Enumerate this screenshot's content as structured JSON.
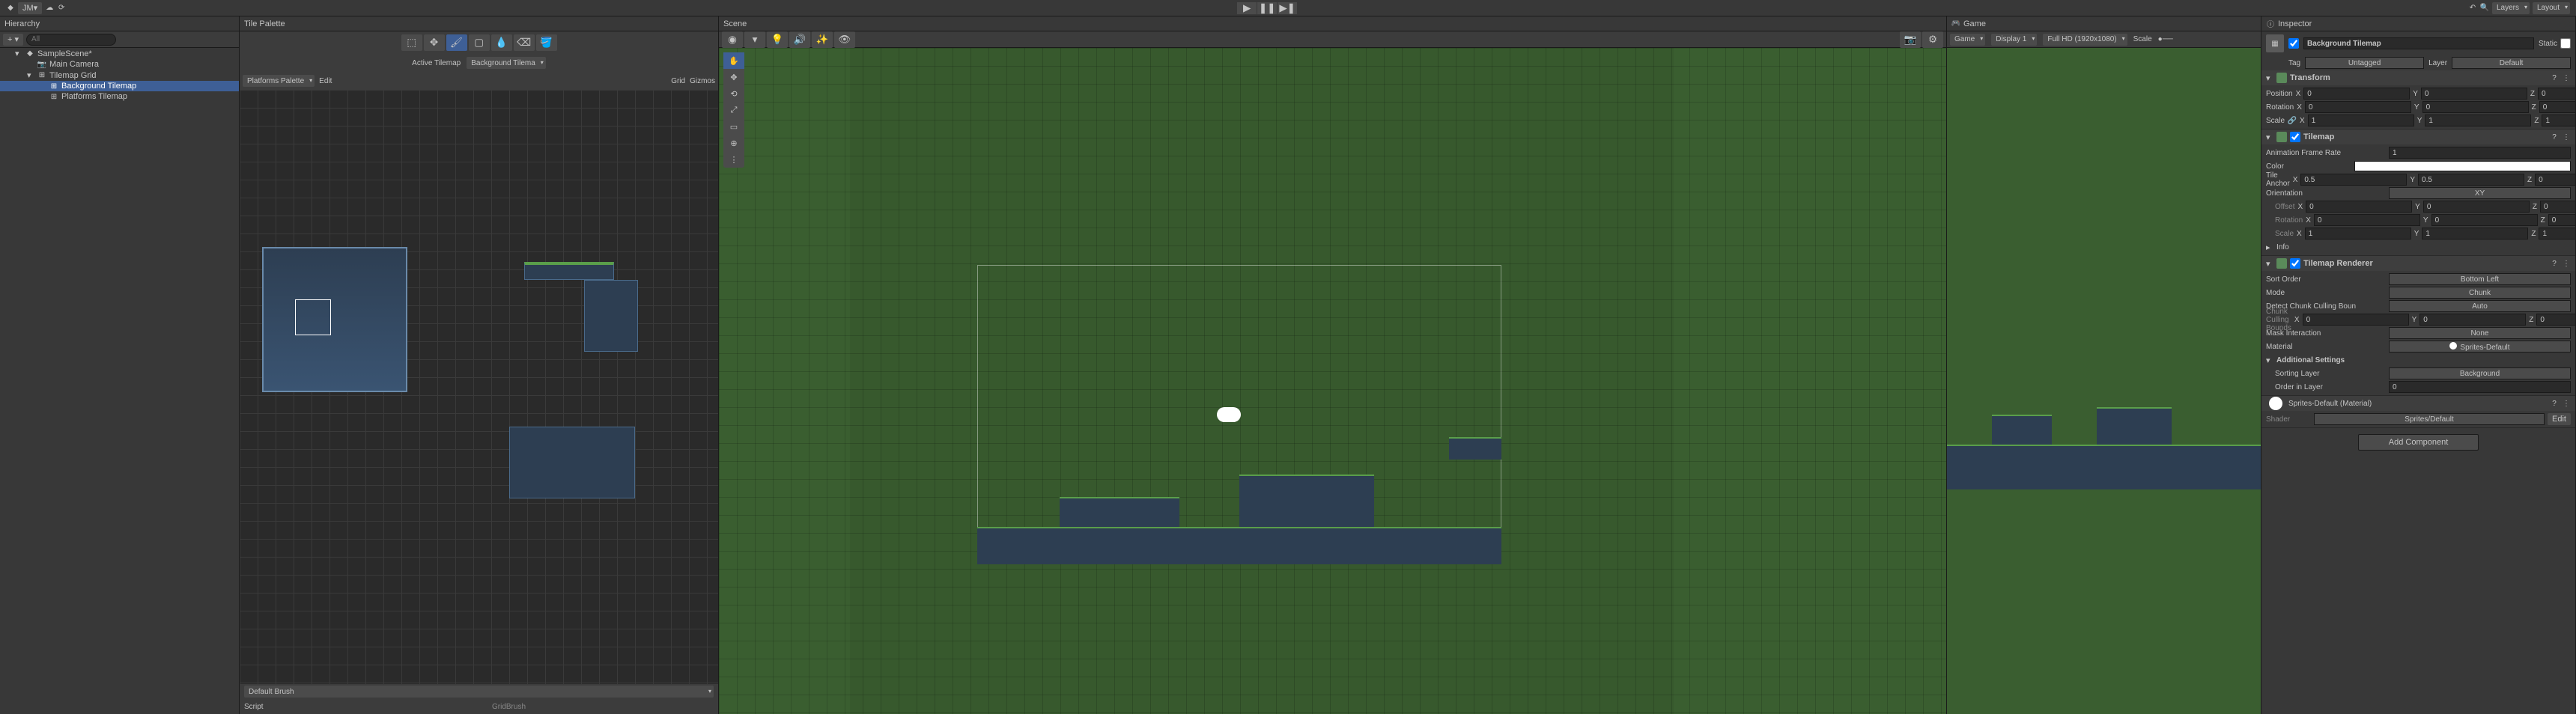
{
  "toolbar": {
    "account": "JM",
    "layers": "Layers",
    "layout": "Layout"
  },
  "hierarchy": {
    "title": "Hierarchy",
    "search_placeholder": "All",
    "items": [
      {
        "label": "SampleScene*",
        "icon": "unity"
      },
      {
        "label": "Main Camera",
        "icon": "camera"
      },
      {
        "label": "Tilemap Grid",
        "icon": "grid"
      },
      {
        "label": "Background Tilemap",
        "icon": "grid"
      },
      {
        "label": "Platforms Tilemap",
        "icon": "grid"
      }
    ]
  },
  "tilePalette": {
    "title": "Tile Palette",
    "active_tilemap_label": "Active Tilemap",
    "active_tilemap": "Background Tilema",
    "palette_label": "Platforms Palette",
    "edit_label": "Edit",
    "grid_label": "Grid",
    "gizmos_label": "Gizmos",
    "brush_label": "Default Brush",
    "script_label": "Script",
    "script_value": "GridBrush"
  },
  "scene": {
    "title": "Scene"
  },
  "game": {
    "title": "Game",
    "display": "Display 1",
    "resolution": "Full HD (1920x1080)",
    "scale_label": "Scale"
  },
  "inspector": {
    "title": "Inspector",
    "object_name": "Background Tilemap",
    "static_label": "Static",
    "tag_label": "Tag",
    "tag_value": "Untagged",
    "layer_label": "Layer",
    "layer_value": "Default",
    "add_component": "Add Component",
    "transform": {
      "title": "Transform",
      "position_label": "Position",
      "rotation_label": "Rotation",
      "scale_label": "Scale",
      "pos": {
        "x": "0",
        "y": "0",
        "z": "0"
      },
      "rot": {
        "x": "0",
        "y": "0",
        "z": "0"
      },
      "scale": {
        "x": "1",
        "y": "1",
        "z": "1"
      }
    },
    "tilemap": {
      "title": "Tilemap",
      "frame_rate_label": "Animation Frame Rate",
      "frame_rate": "1",
      "color_label": "Color",
      "anchor_label": "Tile Anchor",
      "anchor": {
        "x": "0.5",
        "y": "0.5",
        "z": "0"
      },
      "orientation_label": "Orientation",
      "orientation": "XY",
      "offset_label": "Offset",
      "offset": {
        "x": "0",
        "y": "0",
        "z": "0"
      },
      "rotation_label": "Rotation",
      "rotation": {
        "x": "0",
        "y": "0",
        "z": "0"
      },
      "scale_label": "Scale",
      "scale": {
        "x": "1",
        "y": "1",
        "z": "1"
      },
      "info_label": "Info"
    },
    "renderer": {
      "title": "Tilemap Renderer",
      "sort_order_label": "Sort Order",
      "sort_order": "Bottom Left",
      "mode_label": "Mode",
      "mode": "Chunk",
      "detect_label": "Detect Chunk Culling Boun",
      "detect": "Auto",
      "bounds_label": "Chunk Culling Bounds",
      "bounds": {
        "x": "0",
        "y": "0",
        "z": "0"
      },
      "mask_label": "Mask Interaction",
      "mask": "None",
      "material_label": "Material",
      "material": "Sprites-Default",
      "additional_label": "Additional Settings",
      "sorting_layer_label": "Sorting Layer",
      "sorting_layer": "Background",
      "order_label": "Order in Layer",
      "order": "0"
    },
    "material_section": {
      "title": "Sprites-Default (Material)",
      "shader_label": "Shader",
      "shader": "Sprites/Default",
      "edit_label": "Edit"
    }
  }
}
